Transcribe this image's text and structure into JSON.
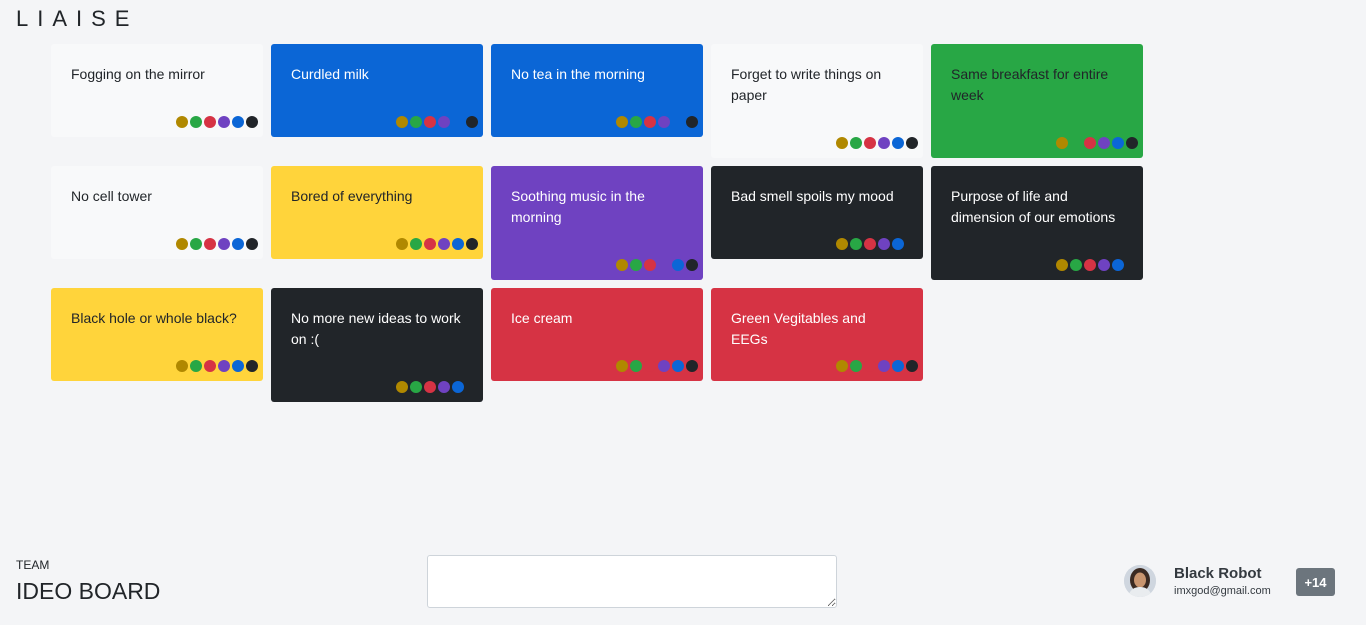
{
  "app": {
    "brand": "LIAISE"
  },
  "palette": [
    "#b08800",
    "#28a745",
    "#d63344",
    "#6f42c1",
    "#0b66d6",
    "#212529"
  ],
  "cards": [
    {
      "text": "Fogging on the mirror",
      "bg": "#f8f9fa",
      "fg": "#212529",
      "hidden_dot": -1
    },
    {
      "text": "Curdled milk",
      "bg": "#0b66d6",
      "fg": "#ffffff",
      "hidden_dot": 4
    },
    {
      "text": "No tea in the morning",
      "bg": "#0b66d6",
      "fg": "#ffffff",
      "hidden_dot": 4
    },
    {
      "text": "Forget to write things on paper",
      "bg": "#f8f9fa",
      "fg": "#212529",
      "hidden_dot": -1
    },
    {
      "text": "Same breakfast for entire week",
      "bg": "#28a745",
      "fg": "#212529",
      "hidden_dot": 1
    },
    {
      "text": "No cell tower",
      "bg": "#f8f9fa",
      "fg": "#212529",
      "hidden_dot": -1
    },
    {
      "text": "Bored of everything",
      "bg": "#ffd43b",
      "fg": "#212529",
      "hidden_dot": -1
    },
    {
      "text": "Soothing music in the morning",
      "bg": "#6f42c1",
      "fg": "#ffffff",
      "hidden_dot": 3
    },
    {
      "text": "Bad smell spoils my mood",
      "bg": "#212529",
      "fg": "#ffffff",
      "hidden_dot": 5
    },
    {
      "text": "Purpose of life and dimension of our emotions",
      "bg": "#212529",
      "fg": "#ffffff",
      "hidden_dot": 5
    },
    {
      "text": "Black hole or whole black?",
      "bg": "#ffd43b",
      "fg": "#212529",
      "hidden_dot": -1
    },
    {
      "text": "No more new ideas to work on :(",
      "bg": "#212529",
      "fg": "#ffffff",
      "hidden_dot": 5
    },
    {
      "text": "Ice cream",
      "bg": "#d63344",
      "fg": "#ffffff",
      "hidden_dot": -1
    },
    {
      "text": "Green Vegitables and EEGs",
      "bg": "#d63344",
      "fg": "#ffffff",
      "hidden_dot": -1
    }
  ],
  "footer": {
    "team_label": "TEAM",
    "board_title": "IDEO BOARD",
    "input_value": "",
    "user": {
      "name": "Black Robot",
      "email": "imxgod@gmail.com",
      "extra_count": "+14"
    }
  }
}
